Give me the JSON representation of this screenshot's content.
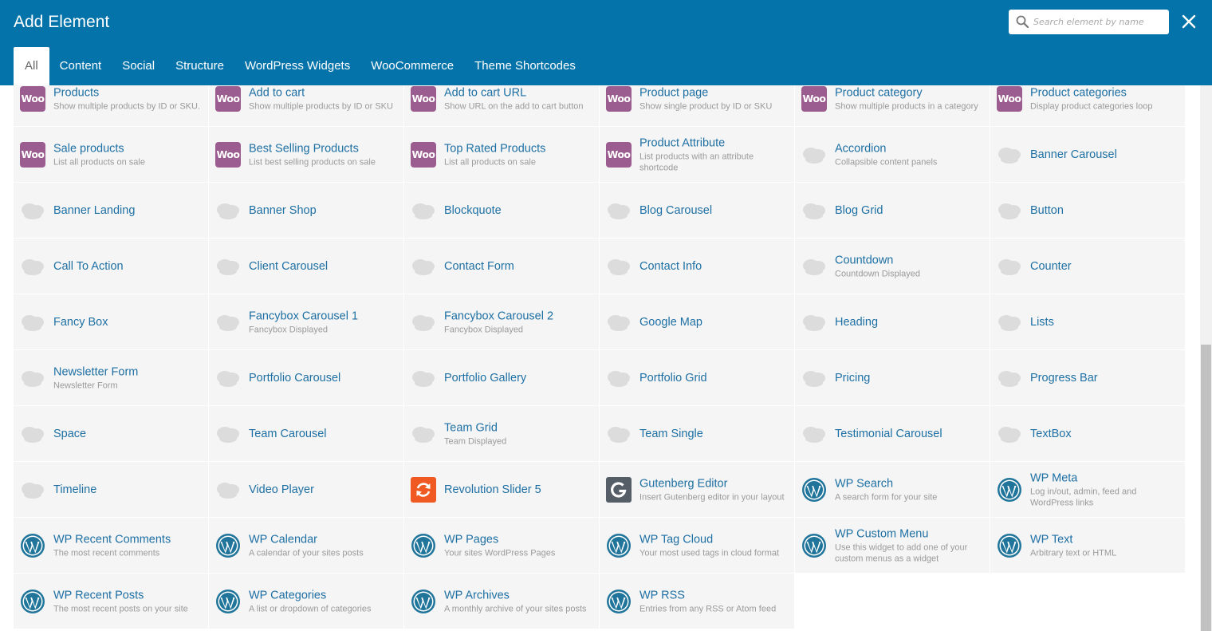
{
  "header": {
    "title": "Add Element",
    "search_placeholder": "Search element by name",
    "search_value": ""
  },
  "tabs": [
    {
      "label": "All",
      "active": true
    },
    {
      "label": "Content",
      "active": false
    },
    {
      "label": "Social",
      "active": false
    },
    {
      "label": "Structure",
      "active": false
    },
    {
      "label": "WordPress Widgets",
      "active": false
    },
    {
      "label": "WooCommerce",
      "active": false
    },
    {
      "label": "Theme Shortcodes",
      "active": false
    }
  ],
  "colors": {
    "header": "#0473aa",
    "woo": "#9b5c8f",
    "link": "#1e70a4",
    "revolution": "#f05a22",
    "gutenberg": "#555d66",
    "wordpress": "#21759b"
  },
  "elements": [
    {
      "name": "Products",
      "desc": "Show multiple products by ID or SKU.",
      "icon": "woo-icon"
    },
    {
      "name": "Add to cart",
      "desc": "Show multiple products by ID or SKU",
      "icon": "woo-icon"
    },
    {
      "name": "Add to cart URL",
      "desc": "Show URL on the add to cart button",
      "icon": "woo-icon"
    },
    {
      "name": "Product page",
      "desc": "Show single product by ID or SKU",
      "icon": "woo-icon"
    },
    {
      "name": "Product category",
      "desc": "Show multiple products in a category",
      "icon": "woo-icon"
    },
    {
      "name": "Product categories",
      "desc": "Display product categories loop",
      "icon": "woo-icon"
    },
    {
      "name": "Sale products",
      "desc": "List all products on sale",
      "icon": "woo-icon"
    },
    {
      "name": "Best Selling Products",
      "desc": "List best selling products on sale",
      "icon": "woo-icon"
    },
    {
      "name": "Top Rated Products",
      "desc": "List all products on sale",
      "icon": "woo-icon"
    },
    {
      "name": "Product Attribute",
      "desc": "List products with an attribute shortcode",
      "icon": "woo-icon"
    },
    {
      "name": "Accordion",
      "desc": "Collapsible content panels",
      "icon": "cloud-icon"
    },
    {
      "name": "Banner Carousel",
      "desc": "",
      "icon": "cloud-icon"
    },
    {
      "name": "Banner Landing",
      "desc": "",
      "icon": "cloud-icon"
    },
    {
      "name": "Banner Shop",
      "desc": "",
      "icon": "cloud-icon"
    },
    {
      "name": "Blockquote",
      "desc": "",
      "icon": "cloud-icon"
    },
    {
      "name": "Blog Carousel",
      "desc": "",
      "icon": "cloud-icon"
    },
    {
      "name": "Blog Grid",
      "desc": "",
      "icon": "cloud-icon"
    },
    {
      "name": "Button",
      "desc": "",
      "icon": "cloud-icon"
    },
    {
      "name": "Call To Action",
      "desc": "",
      "icon": "cloud-icon"
    },
    {
      "name": "Client Carousel",
      "desc": "",
      "icon": "cloud-icon"
    },
    {
      "name": "Contact Form",
      "desc": "",
      "icon": "cloud-icon"
    },
    {
      "name": "Contact Info",
      "desc": "",
      "icon": "cloud-icon"
    },
    {
      "name": "Countdown",
      "desc": "Countdown Displayed",
      "icon": "cloud-icon"
    },
    {
      "name": "Counter",
      "desc": "",
      "icon": "cloud-icon"
    },
    {
      "name": "Fancy Box",
      "desc": "",
      "icon": "cloud-icon"
    },
    {
      "name": "Fancybox Carousel 1",
      "desc": "Fancybox Displayed",
      "icon": "cloud-icon"
    },
    {
      "name": "Fancybox Carousel 2",
      "desc": "Fancybox Displayed",
      "icon": "cloud-icon"
    },
    {
      "name": "Google Map",
      "desc": "",
      "icon": "cloud-icon"
    },
    {
      "name": "Heading",
      "desc": "",
      "icon": "cloud-icon"
    },
    {
      "name": "Lists",
      "desc": "",
      "icon": "cloud-icon"
    },
    {
      "name": "Newsletter Form",
      "desc": "Newsletter Form",
      "icon": "cloud-icon"
    },
    {
      "name": "Portfolio Carousel",
      "desc": "",
      "icon": "cloud-icon"
    },
    {
      "name": "Portfolio Gallery",
      "desc": "",
      "icon": "cloud-icon"
    },
    {
      "name": "Portfolio Grid",
      "desc": "",
      "icon": "cloud-icon"
    },
    {
      "name": "Pricing",
      "desc": "",
      "icon": "cloud-icon"
    },
    {
      "name": "Progress Bar",
      "desc": "",
      "icon": "cloud-icon"
    },
    {
      "name": "Space",
      "desc": "",
      "icon": "cloud-icon"
    },
    {
      "name": "Team Carousel",
      "desc": "",
      "icon": "cloud-icon"
    },
    {
      "name": "Team Grid",
      "desc": "Team Displayed",
      "icon": "cloud-icon"
    },
    {
      "name": "Team Single",
      "desc": "",
      "icon": "cloud-icon"
    },
    {
      "name": "Testimonial Carousel",
      "desc": "",
      "icon": "cloud-icon"
    },
    {
      "name": "TextBox",
      "desc": "",
      "icon": "cloud-icon"
    },
    {
      "name": "Timeline",
      "desc": "",
      "icon": "cloud-icon"
    },
    {
      "name": "Video Player",
      "desc": "",
      "icon": "cloud-icon"
    },
    {
      "name": "Revolution Slider 5",
      "desc": "",
      "icon": "revolution-slider-icon"
    },
    {
      "name": "Gutenberg Editor",
      "desc": "Insert Gutenberg editor in your layout",
      "icon": "gutenberg-icon"
    },
    {
      "name": "WP Search",
      "desc": "A search form for your site",
      "icon": "wordpress-icon"
    },
    {
      "name": "WP Meta",
      "desc": "Log in/out, admin, feed and WordPress links",
      "icon": "wordpress-icon"
    },
    {
      "name": "WP Recent Comments",
      "desc": "The most recent comments",
      "icon": "wordpress-icon"
    },
    {
      "name": "WP Calendar",
      "desc": "A calendar of your sites posts",
      "icon": "wordpress-icon"
    },
    {
      "name": "WP Pages",
      "desc": "Your sites WordPress Pages",
      "icon": "wordpress-icon"
    },
    {
      "name": "WP Tag Cloud",
      "desc": "Your most used tags in cloud format",
      "icon": "wordpress-icon"
    },
    {
      "name": "WP Custom Menu",
      "desc": "Use this widget to add one of your custom menus as a widget",
      "icon": "wordpress-icon"
    },
    {
      "name": "WP Text",
      "desc": "Arbitrary text or HTML",
      "icon": "wordpress-icon"
    },
    {
      "name": "WP Recent Posts",
      "desc": "The most recent posts on your site",
      "icon": "wordpress-icon"
    },
    {
      "name": "WP Categories",
      "desc": "A list or dropdown of categories",
      "icon": "wordpress-icon"
    },
    {
      "name": "WP Archives",
      "desc": "A monthly archive of your sites posts",
      "icon": "wordpress-icon"
    },
    {
      "name": "WP RSS",
      "desc": "Entries from any RSS or Atom feed",
      "icon": "wordpress-icon"
    }
  ],
  "woo_icon_text": "Woo"
}
